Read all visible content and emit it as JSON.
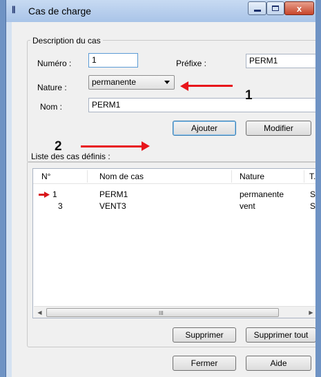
{
  "window": {
    "title": "Cas de charge",
    "icon_glyph": "ꟾꟾ",
    "close_glyph": "x"
  },
  "description": {
    "group_title": "Description du cas",
    "numero_label": "Numéro :",
    "numero_value": "1",
    "prefixe_label": "Préfixe :",
    "prefixe_value": "PERM1",
    "nature_label": "Nature :",
    "nature_value": "permanente",
    "nom_label": "Nom :",
    "nom_value": "PERM1",
    "ajouter_label": "Ajouter",
    "modifier_label": "Modifier"
  },
  "annotations": {
    "label_1": "1",
    "label_2": "2",
    "color": "#e8151b"
  },
  "list": {
    "group_title": "Liste des cas définis :",
    "columns": [
      "N°",
      "Nom de cas",
      "Nature",
      "T."
    ],
    "rows": [
      {
        "num": "1",
        "name": "PERM1",
        "nature": "permanente",
        "type": "S",
        "marker": "red-arrow-icon"
      },
      {
        "num": "3",
        "name": "VENT3",
        "nature": "vent",
        "type": "S",
        "marker": ""
      }
    ],
    "scroll_left_glyph": "◀",
    "scroll_right_glyph": "▶",
    "scroll_grip_glyph": "III",
    "supprimer_label": "Supprimer",
    "supprimer_tout_label": "Supprimer tout"
  },
  "footer": {
    "fermer_label": "Fermer",
    "aide_label": "Aide"
  }
}
